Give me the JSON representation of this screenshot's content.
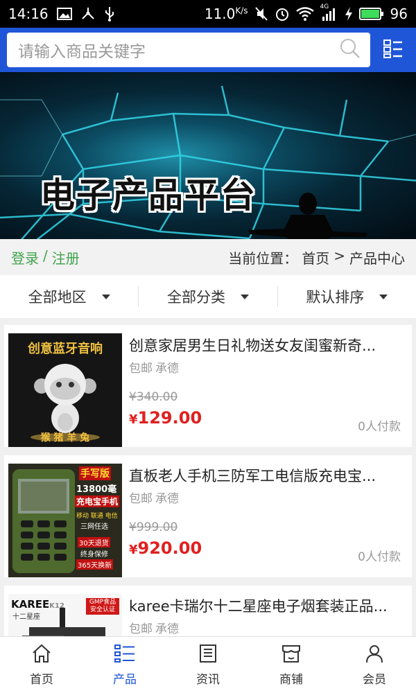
{
  "status_bar": {
    "time": "14:16",
    "speed": "11.0",
    "speed_unit": "K/s",
    "network": "4G",
    "battery": "96",
    "left_icons": [
      "image-icon",
      "usb-tether-icon",
      "usb-icon"
    ],
    "right_icons": [
      "mute-icon",
      "alarm-icon",
      "wifi-icon",
      "signal-icon",
      "charging-icon",
      "battery-icon"
    ]
  },
  "search": {
    "placeholder": "请输入商品关键字"
  },
  "banner": {
    "title": "电子产品平台"
  },
  "location_bar": {
    "login": "登录",
    "separator": "/",
    "register": "注册",
    "label": "当前位置：",
    "home": "首页",
    "arrow": ">",
    "current": "产品中心"
  },
  "filters": [
    {
      "label": "全部地区"
    },
    {
      "label": "全部分类"
    },
    {
      "label": "默认排序"
    }
  ],
  "products": [
    {
      "title": "创意家居男生日礼物送女友闺蜜新奇...",
      "tags": [
        "包邮",
        "承德"
      ],
      "old_price": "¥340.00",
      "currency": "¥",
      "price": "129.00",
      "paid": "0人付款",
      "image_text": "创意蓝牙音响",
      "image_bottom": "猴 猪 羊 兔"
    },
    {
      "title": "直板老人手机三防军工电信版充电宝...",
      "tags": [
        "包邮",
        "承德"
      ],
      "old_price": "¥999.00",
      "currency": "¥",
      "price": "920.00",
      "paid": "0人付款",
      "image_text": "手写版",
      "image_sub": "13800毫安",
      "image_line2": "充电宝手机",
      "image_line3": "移动 联通 电信",
      "image_line4": "三网任选",
      "image_line5": "30天退货",
      "image_line6": "终身保修",
      "image_line7": "365天换新"
    },
    {
      "title": "karee卡瑞尔十二星座电子烟套装正品...",
      "tags": [
        "包邮",
        "承德"
      ],
      "image_brand": "KAREE",
      "image_brand_sub": "K12",
      "image_brand_cn": "十二星座",
      "image_badge": "GMP食品",
      "image_badge2": "安全认证"
    }
  ],
  "bottom_nav": [
    {
      "label": "首页",
      "icon": "home-icon",
      "active": false
    },
    {
      "label": "产品",
      "icon": "list-icon",
      "active": true
    },
    {
      "label": "资讯",
      "icon": "news-icon",
      "active": false
    },
    {
      "label": "商铺",
      "icon": "shop-icon",
      "active": false
    },
    {
      "label": "会员",
      "icon": "user-icon",
      "active": false
    }
  ],
  "colors": {
    "brand_blue": "#1f56d8",
    "price_red": "#e02020",
    "login_green": "#3fa34d"
  }
}
